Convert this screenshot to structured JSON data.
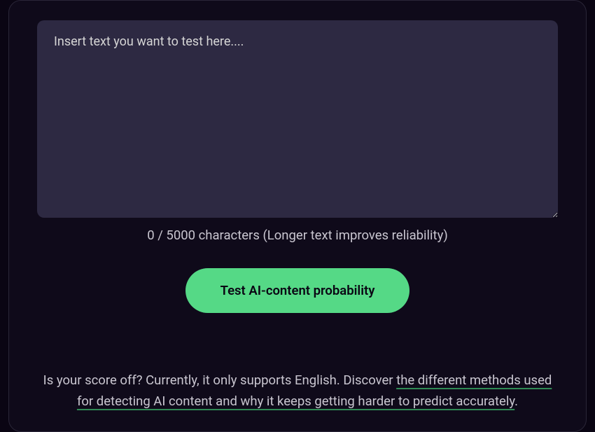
{
  "input": {
    "placeholder": "Insert text you want to test here....",
    "value": ""
  },
  "counter": {
    "current": 0,
    "max": 5000,
    "label": "0 / 5000 characters (Longer text improves reliability)"
  },
  "action": {
    "test_label": "Test AI-content probability"
  },
  "footer": {
    "prefix": "Is your score off? Currently, it only supports English. Discover ",
    "link_text": "the different methods used for detecting AI content and why it keeps getting harder to predict accurately",
    "suffix": "."
  },
  "colors": {
    "background": "#0a0513",
    "card": "#0f0a1a",
    "textarea_bg": "#2d2942",
    "accent": "#55d986",
    "text": "#c9c6d0",
    "link_underline": "#2f8a55"
  }
}
